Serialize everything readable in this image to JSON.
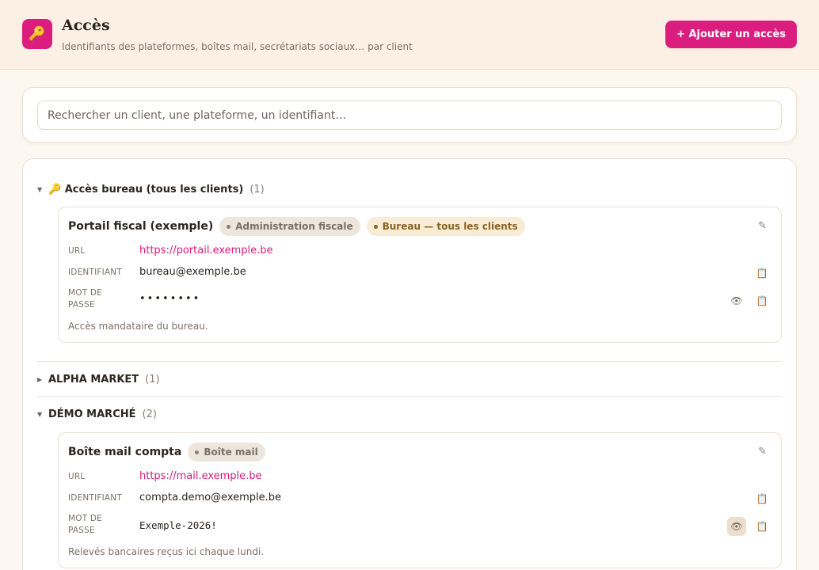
{
  "header": {
    "app_icon": "key-icon",
    "title": "Accès",
    "subtitle": "Identifiants des plateformes, boîtes mail, secrétariats sociaux… par client",
    "add_button_label": "+ Ajouter un accès",
    "accent_color": "#dc1d80"
  },
  "search": {
    "placeholder": "Rechercher un client, une plateforme, un identifiant…",
    "value": ""
  },
  "groups": [
    {
      "title": "🔑 Accès bureau (tous les clients)",
      "count": "(1)",
      "expanded": true,
      "entries": [
        {
          "title": "Portail fiscal (exemple)",
          "tags": [
            "Administration fiscale",
            "Bureau — tous les clients"
          ],
          "url_label": "URL",
          "url": "https://portail.exemple.be",
          "id_label": "IDENTIFIANT",
          "identifier": "bureau@exemple.be",
          "pw_label_1": "MOT DE",
          "pw_label_2": "PASSE",
          "password": "••••••••",
          "note": "Accès mandataire du bureau."
        }
      ]
    },
    {
      "title": "ALPHA MARKET",
      "count": "(1)",
      "expanded": false
    },
    {
      "title": "DÉMO MARCHÉ",
      "count": "(2)",
      "expanded": true,
      "entries": [
        {
          "title": "Boîte mail compta",
          "tags": [
            "Boîte mail"
          ],
          "url_label": "URL",
          "url": "https://mail.exemple.be",
          "id_label": "IDENTIFIANT",
          "identifier": "compta.demo@exemple.be",
          "pw_label_1": "MOT DE",
          "pw_label_2": "PASSE",
          "password": "Exemple-2026!",
          "note": "Relevés bancaires reçus ici chaque lundi."
        }
      ]
    }
  ],
  "icons": {
    "edit": "pencil-icon",
    "copy": "clipboard-icon",
    "reveal": "eye-icon",
    "expanded": "caret-down-icon",
    "collapsed": "caret-right-icon"
  }
}
